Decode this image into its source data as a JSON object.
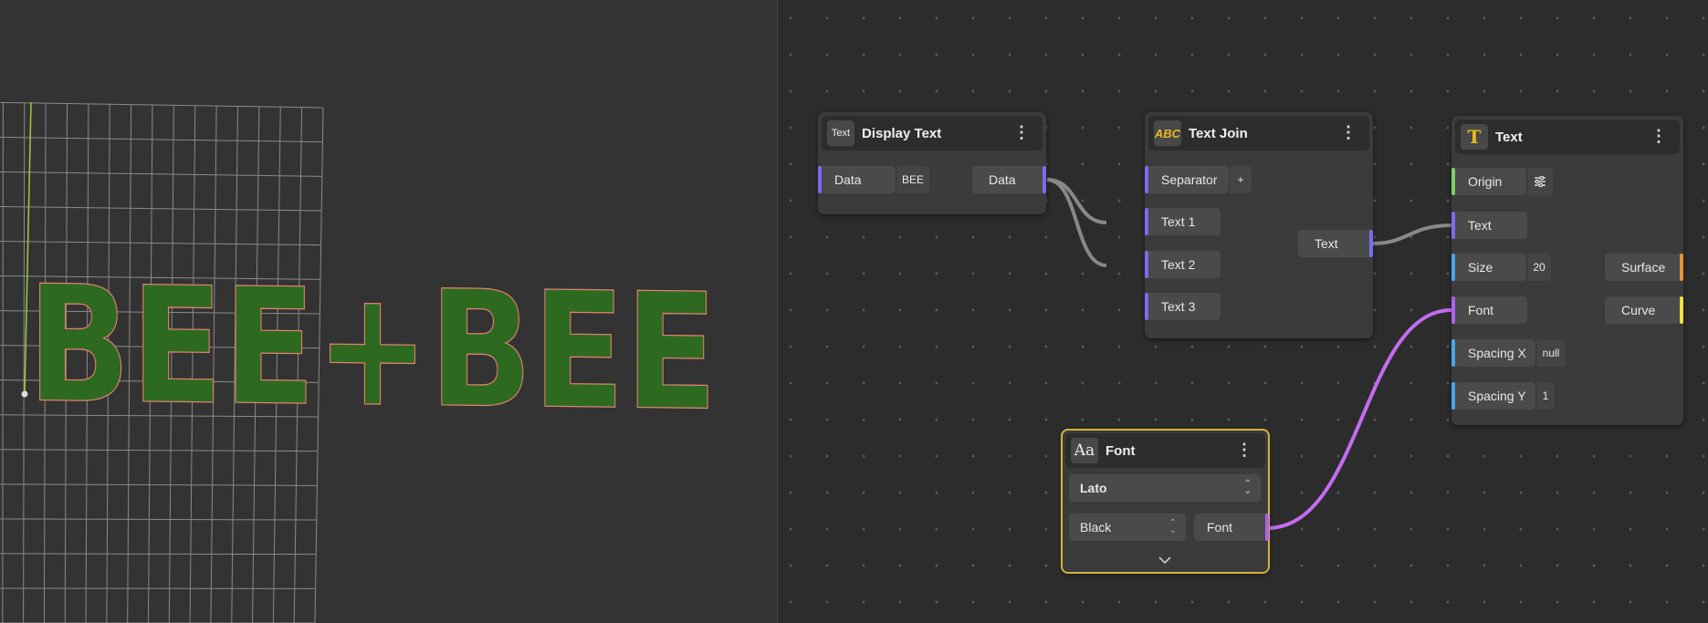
{
  "viewport": {
    "text_render": "BEE+BEE",
    "colors": {
      "background": "#333333",
      "grid": "#8a8a8a",
      "fill": "#2d6a1f",
      "outline": "#e08070",
      "axis_y": "#9ad03a"
    }
  },
  "editor": {
    "colors": {
      "wire_default": "#888888",
      "wire_font": "#c36cf0",
      "port_data": "#7a6cf0",
      "port_origin": "#7fd06a",
      "port_text": "#7a6cf0",
      "port_number": "#46a8e8",
      "port_font": "#b060f0",
      "port_surface": "#e8913c",
      "port_curve": "#f0e040",
      "selected_outline": "#d4b23c"
    },
    "nodes": {
      "display_text": {
        "icon": "text-label-icon",
        "icon_text": "Text",
        "title": "Display Text",
        "input": {
          "label": "Data",
          "value": "BEE"
        },
        "output": {
          "label": "Data"
        }
      },
      "text_join": {
        "icon": "abc-icon",
        "icon_text": "ABC",
        "title": "Text Join",
        "separator": {
          "label": "Separator",
          "value": "+"
        },
        "inputs": [
          "Text 1",
          "Text 2",
          "Text 3"
        ],
        "output": {
          "label": "Text"
        }
      },
      "text": {
        "icon": "serif-t-icon",
        "icon_text": "T",
        "title": "Text",
        "origin": {
          "label": "Origin",
          "icon": "sliders-icon"
        },
        "text_in": {
          "label": "Text"
        },
        "size": {
          "label": "Size",
          "value": "20"
        },
        "font": {
          "label": "Font"
        },
        "spacing_x": {
          "label": "Spacing X",
          "value": "null"
        },
        "spacing_y": {
          "label": "Spacing Y",
          "value": "1"
        },
        "outputs": [
          "Surface",
          "Curve"
        ]
      },
      "font": {
        "icon": "font-aa-icon",
        "icon_text": "Aa",
        "title": "Font",
        "family": "Lato",
        "weight": "Black",
        "output": {
          "label": "Font"
        },
        "expand_icon": "chevron-down-icon"
      }
    }
  }
}
